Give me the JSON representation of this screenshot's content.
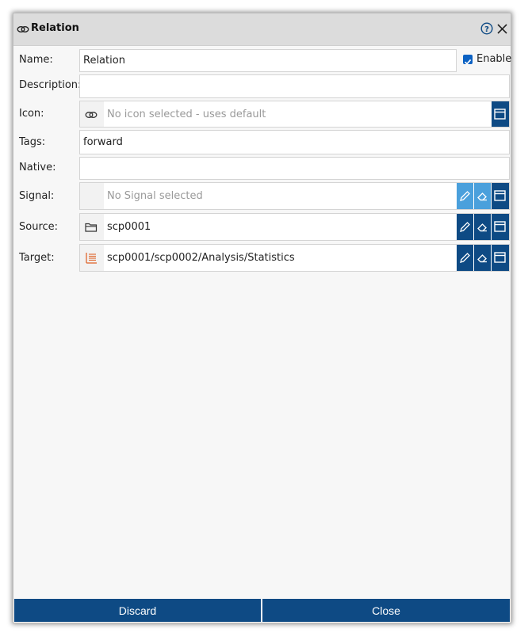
{
  "dialog": {
    "title": "Relation",
    "title_icon": "link-icon",
    "help_icon": "help-icon",
    "close_icon": "close-icon"
  },
  "fields": {
    "name": {
      "label": "Name:",
      "value": "Relation"
    },
    "enable": {
      "label": "Enable",
      "checked": true
    },
    "description": {
      "label": "Description:",
      "value": ""
    },
    "icon": {
      "label": "Icon:",
      "placeholder": "No icon selected - uses default"
    },
    "tags": {
      "label": "Tags:",
      "value": "forward"
    },
    "native": {
      "label": "Native:",
      "value": ""
    },
    "signal": {
      "label": "Signal:",
      "placeholder": "No Signal selected"
    },
    "source": {
      "label": "Source:",
      "value": "scp0001",
      "icon": "folder-icon"
    },
    "target": {
      "label": "Target:",
      "value": "scp0001/scp0002/Analysis/Statistics",
      "icon": "list-report-icon"
    }
  },
  "footer": {
    "discard_label": "Discard",
    "close_label": "Close"
  },
  "colors": {
    "accent": "#0e4a84",
    "accent_light": "#4aa0dc",
    "target_icon": "#e0703a"
  }
}
